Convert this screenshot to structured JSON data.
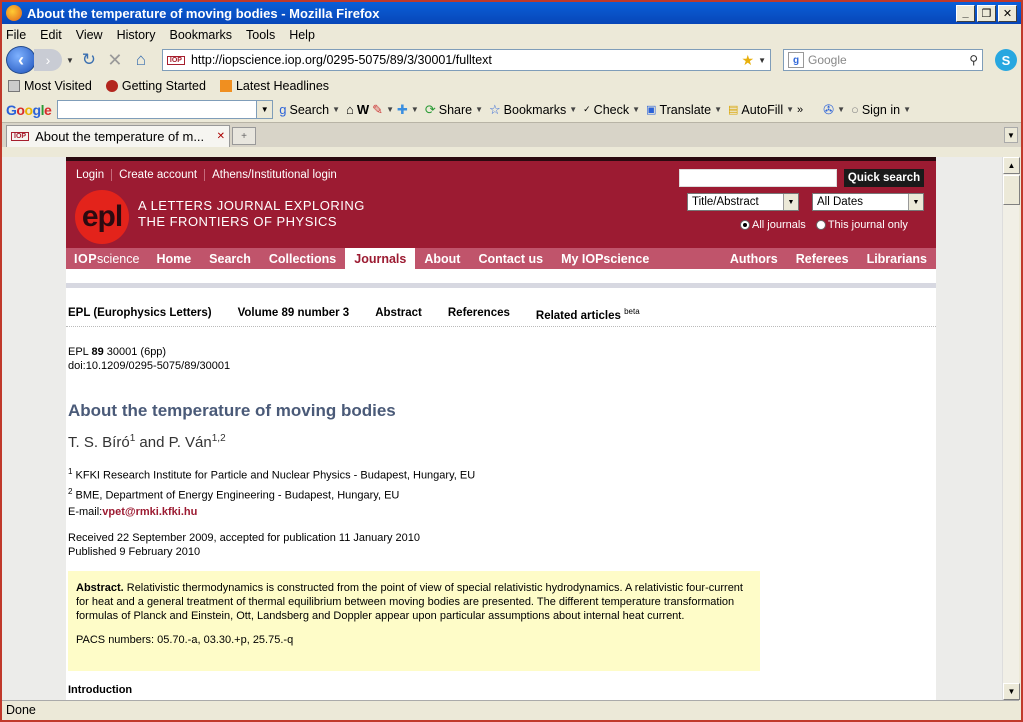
{
  "window": {
    "title": "About the temperature of moving bodies - Mozilla Firefox"
  },
  "menu": [
    "File",
    "Edit",
    "View",
    "History",
    "Bookmarks",
    "Tools",
    "Help"
  ],
  "nav": {
    "url": "http://iopscience.iop.org/0295-5075/89/3/30001/fulltext",
    "search_placeholder": "Google"
  },
  "bookmarks": [
    "Most Visited",
    "Getting Started",
    "Latest Headlines"
  ],
  "google_toolbar": {
    "logo": "Google",
    "items": [
      "Search",
      "Share",
      "Bookmarks",
      "Check",
      "Translate",
      "AutoFill",
      "Sign in"
    ]
  },
  "tab": {
    "title": "About the temperature of m..."
  },
  "status": "Done",
  "site": {
    "toplinks": [
      "Login",
      "Create account",
      "Athens/Institutional login"
    ],
    "logo": "epl",
    "tagline1": "A LETTERS JOURNAL EXPLORING",
    "tagline2": "THE FRONTIERS OF PHYSICS",
    "quick_search": "Quick search",
    "select_field": "Title/Abstract",
    "select_dates": "All Dates",
    "radio_all": "All journals",
    "radio_this": "This journal only",
    "iop_brand_a": "IOP",
    "iop_brand_b": "science",
    "nav_items": [
      "Home",
      "Search",
      "Collections",
      "Journals",
      "About",
      "Contact us",
      "My IOPscience"
    ],
    "nav_right": [
      "Authors",
      "Referees",
      "Librarians"
    ]
  },
  "subnav": {
    "journal": "EPL (Europhysics Letters)",
    "volume": "Volume 89 number 3",
    "abstract": "Abstract",
    "references": "References",
    "related": "Related articles",
    "beta": "beta"
  },
  "article": {
    "cite_prefix": "EPL",
    "cite_volume": "89",
    "cite_rest": "30001 (6pp)",
    "doi": "doi:10.1209/0295-5075/89/30001",
    "title": "About the temperature of moving bodies",
    "author1": "T. S. Bíró",
    "author1_sup": "1",
    "and": "and",
    "author2": "P. Ván",
    "author2_sup": "1,2",
    "affil1_sup": "1",
    "affil1": "KFKI Research Institute for Particle and Nuclear Physics - Budapest, Hungary, EU",
    "affil2_sup": "2",
    "affil2": "BME, Department of Energy Engineering - Budapest, Hungary, EU",
    "email_label": "E-mail:",
    "email": "vpet@rmki.kfki.hu",
    "received": "Received 22 September 2009, accepted for publication 11 January 2010",
    "published": "Published 9 February 2010",
    "abstract_label": "Abstract.",
    "abstract_text": "Relativistic thermodynamics is constructed from the point of view of special relativistic hydrodynamics. A relativistic four-current for heat and a general treatment of thermal equilibrium between moving bodies are presented. The different temperature transformation formulas of Planck and Einstein, Ott, Landsberg and Doppler appear upon particular assumptions about internal heat current.",
    "pacs": "PACS numbers: 05.70.-a, 03.30.+p, 25.75.-q",
    "intro": "Introduction"
  }
}
